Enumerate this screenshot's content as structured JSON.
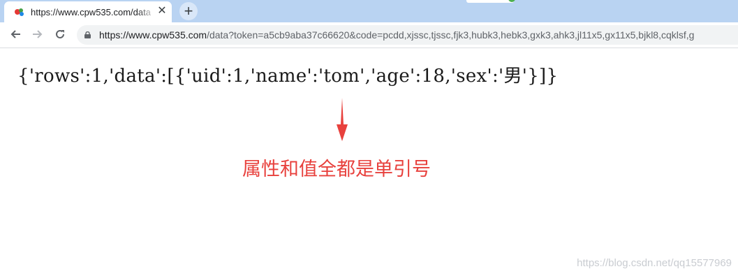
{
  "browser": {
    "tab_title": "https://www.cpw535.com/data",
    "tab_close_icon": "close-icon",
    "new_tab_icon": "plus-icon",
    "address_host": "https://www.cpw535.com",
    "address_rest": "/data?token=a5cb9aba37c66620&code=pcdd,xjssc,tjssc,fjk3,hubk3,hebk3,gxk3,ahk3,jl11x5,gx11x5,bjkl8,cqklsf,g",
    "icons": {
      "back": "back-arrow-icon",
      "forward": "forward-arrow-icon",
      "reload": "reload-icon",
      "lock": "lock-icon",
      "favicon": "site-favicon-icon"
    }
  },
  "content": {
    "json_text": "{'rows':1,'data':[{'uid':1,'name':'tom','age':18,'sex':'男'}]}",
    "annotation": "属性和值全都是单引号",
    "annotation_color": "#e8413d",
    "arrow_icon": "down-arrow-icon"
  },
  "watermark": "https://blog.csdn.net/qq15577969"
}
